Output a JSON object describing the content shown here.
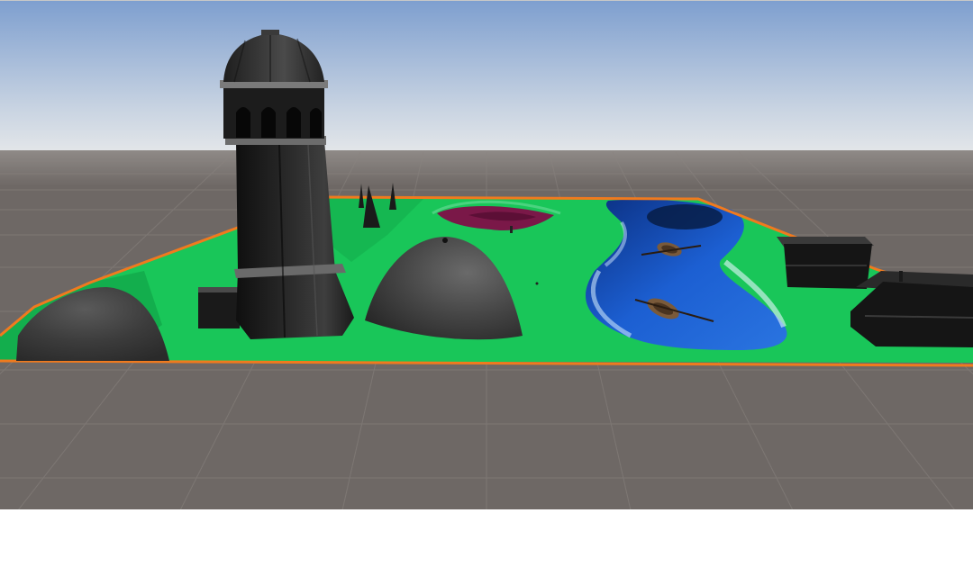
{
  "scene": {
    "colors": {
      "sky_top": "#7e9fcf",
      "sky_horizon": "#e3e6e9",
      "ground": "#6e6865",
      "grid_line": "#8a8480",
      "terrain": "#19c659",
      "terrain_dark": "#0f9a43",
      "selection_outline": "#f07a1e",
      "water": "#1c5fd2",
      "water_dark": "#0b2f80",
      "crater": "#7a1848",
      "building": "#151515",
      "building_light": "#4a4a4a",
      "boat": "#7a5a3a"
    },
    "objects": {
      "tower": "lighthouse-tower",
      "hill_left": "grey-hill",
      "hill_center": "grey-hill",
      "water": "river",
      "boats": [
        "rowboat",
        "rowboat"
      ],
      "buildings": [
        "house",
        "house"
      ],
      "spires": [
        "spire",
        "spire",
        "spire"
      ]
    }
  }
}
